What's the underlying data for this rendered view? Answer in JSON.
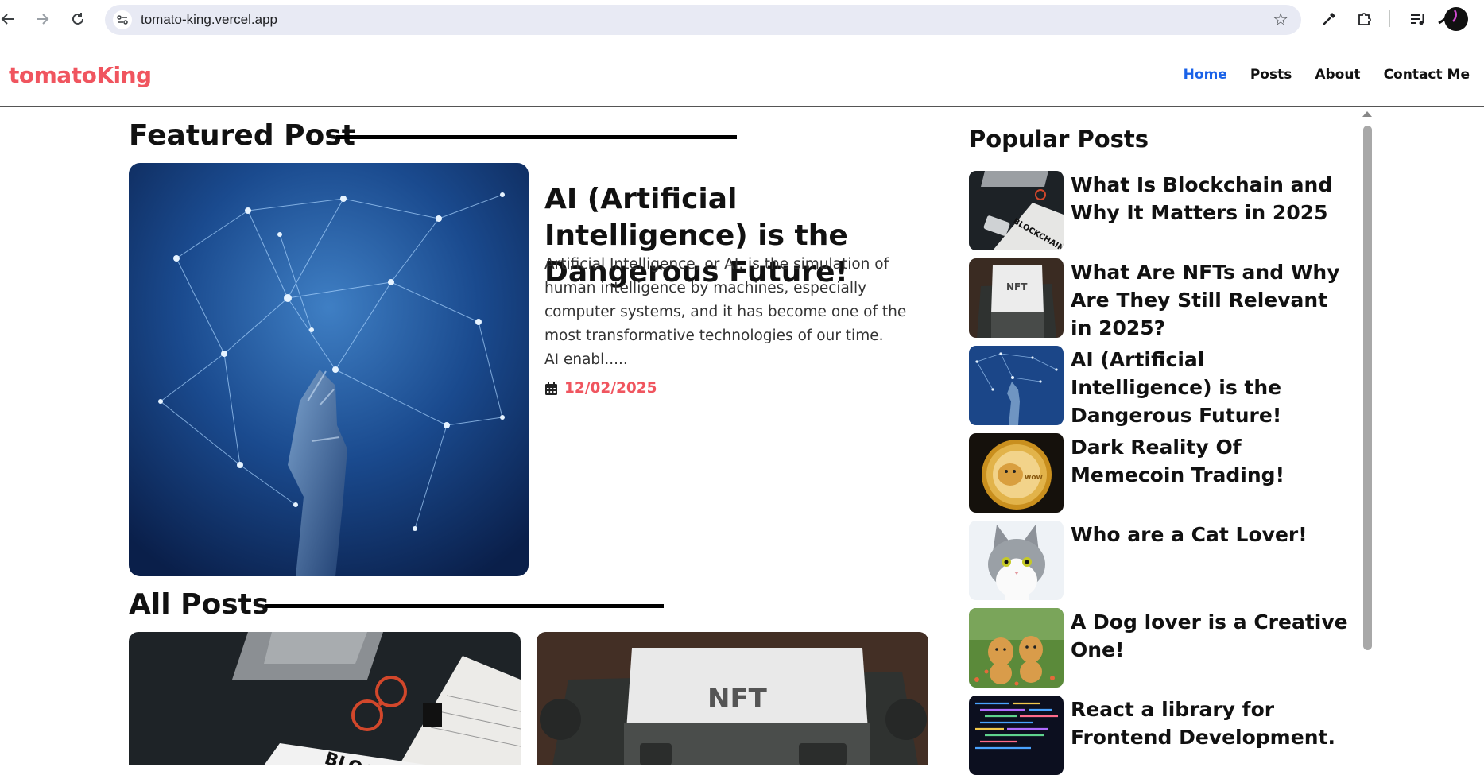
{
  "browser": {
    "url": "tomato-king.vercel.app",
    "back_icon": "arrow-left-icon",
    "forward_icon": "arrow-right-icon",
    "reload_icon": "reload-icon"
  },
  "site": {
    "logo": "tomatoKing",
    "nav": {
      "home": "Home",
      "posts": "Posts",
      "about": "About",
      "contact": "Contact Me"
    }
  },
  "featured": {
    "section_title": "Featured Post",
    "title": "AI (Artificial Intelligence) is the Dangerous Future!",
    "desc": "Artificial Intelligence, or AI, is the simulation of human intelligence by machines, especially computer systems, and it has become one of the most transformative technologies of our time.",
    "desc_tail": "AI enabl.....",
    "date": "12/02/2025"
  },
  "all_posts": {
    "section_title": "All Posts"
  },
  "popular": {
    "section_title": "Popular Posts",
    "items": [
      {
        "title": "What Is Blockchain and Why It Matters in 2025"
      },
      {
        "title": "What Are NFTs and Why Are They Still Relevant in 2025?"
      },
      {
        "title": "AI (Artificial Intelligence) is the Dangerous Future!"
      },
      {
        "title": "Dark Reality Of Memecoin Trading!"
      },
      {
        "title": "Who are a Cat Lover!"
      },
      {
        "title": "A Dog lover is a Creative One!"
      },
      {
        "title": "React a library for Frontend Development."
      }
    ]
  },
  "colors": {
    "brand": "#f0555f",
    "nav_active": "#1a62e8"
  }
}
